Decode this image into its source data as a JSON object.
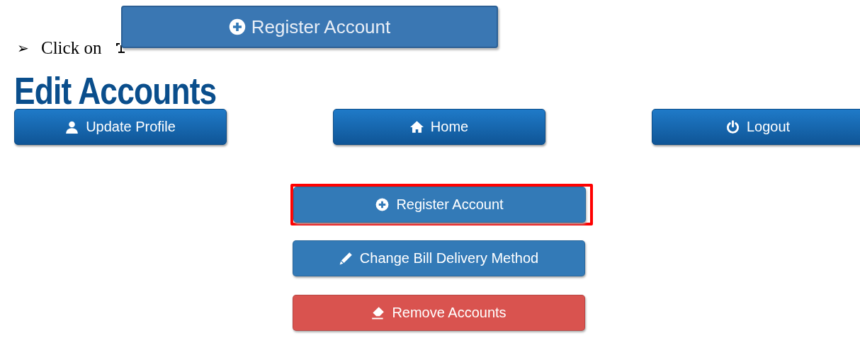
{
  "instruction": {
    "bullet": "➢",
    "text": "Click on",
    "button": {
      "label": "Register Account",
      "kind": "register"
    }
  },
  "title": "Edit Accounts",
  "nav_buttons": [
    {
      "label": "Update Profile",
      "kind": "profile"
    },
    {
      "label": "Home",
      "kind": "home"
    },
    {
      "label": "Logout",
      "kind": "logout"
    }
  ],
  "actions": [
    {
      "label": "Register Account",
      "kind": "register",
      "color": "#337ab7",
      "highlighted": true
    },
    {
      "label": "Change Bill Delivery Method",
      "kind": "edit",
      "color": "#337ab7",
      "highlighted": false
    },
    {
      "label": "Remove Accounts",
      "kind": "remove",
      "color": "#d9534f",
      "highlighted": false
    }
  ]
}
